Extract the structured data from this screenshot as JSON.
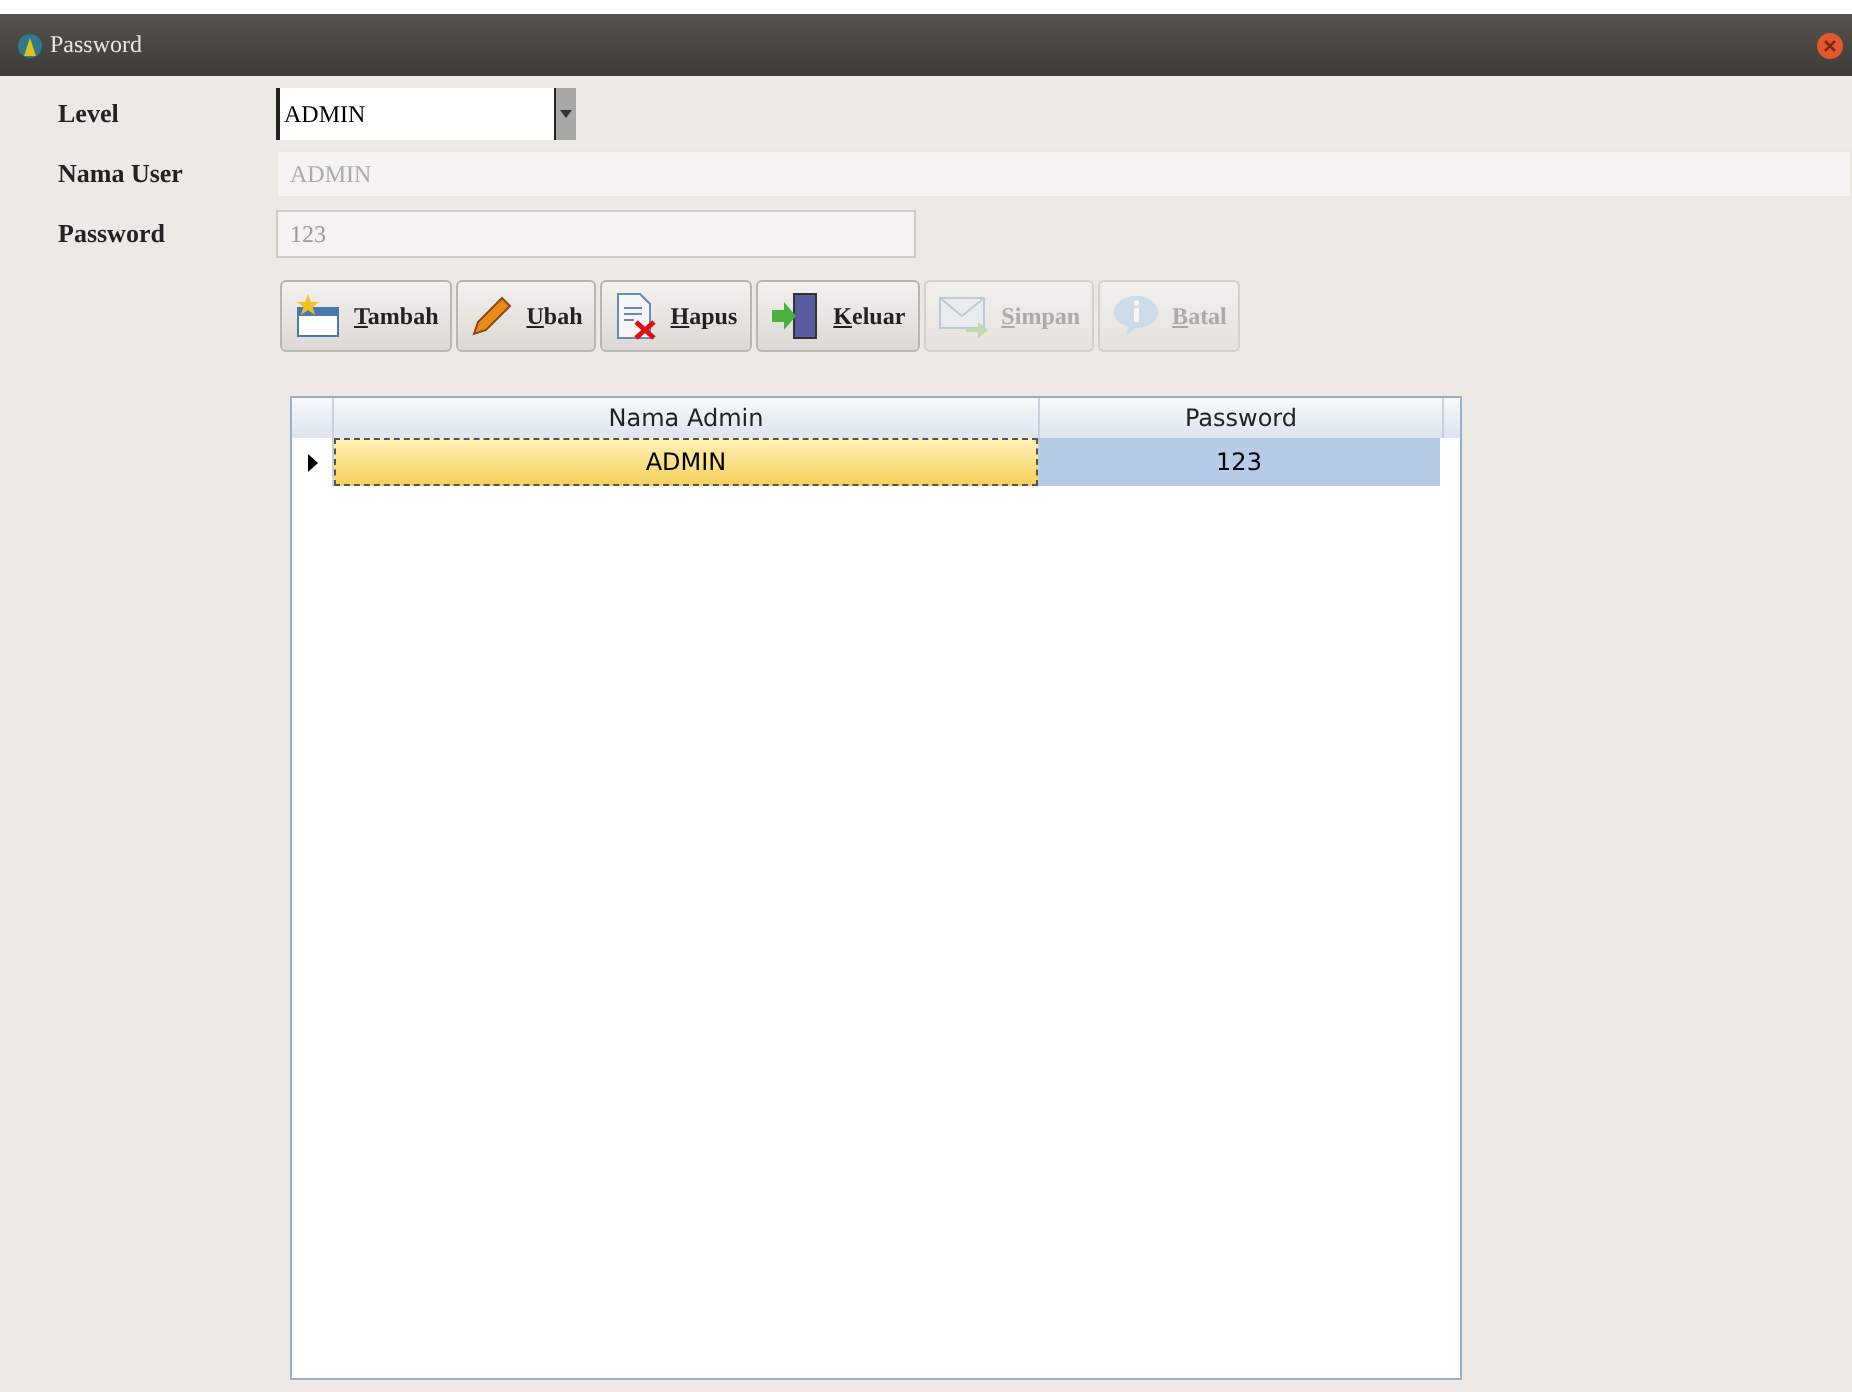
{
  "window": {
    "title": "Password"
  },
  "form": {
    "level": {
      "label": "Level",
      "value": "ADMIN"
    },
    "nama_user": {
      "label": "Nama User",
      "value": "ADMIN",
      "disabled": true
    },
    "password": {
      "label": "Password",
      "value": "123"
    }
  },
  "buttons": [
    {
      "label": "Tambah",
      "kind": "add",
      "disabled": false
    },
    {
      "label": "Ubah",
      "kind": "edit",
      "disabled": false
    },
    {
      "label": "Hapus",
      "kind": "delete",
      "disabled": false
    },
    {
      "label": "Keluar",
      "kind": "exit",
      "disabled": false
    },
    {
      "label": "Simpan",
      "kind": "save",
      "disabled": true
    },
    {
      "label": "Batal",
      "kind": "cancel",
      "disabled": true
    }
  ],
  "table": {
    "columns": [
      "Nama Admin",
      "Password"
    ],
    "rows": [
      {
        "cells": [
          "ADMIN",
          "123"
        ],
        "selected": true
      }
    ]
  }
}
